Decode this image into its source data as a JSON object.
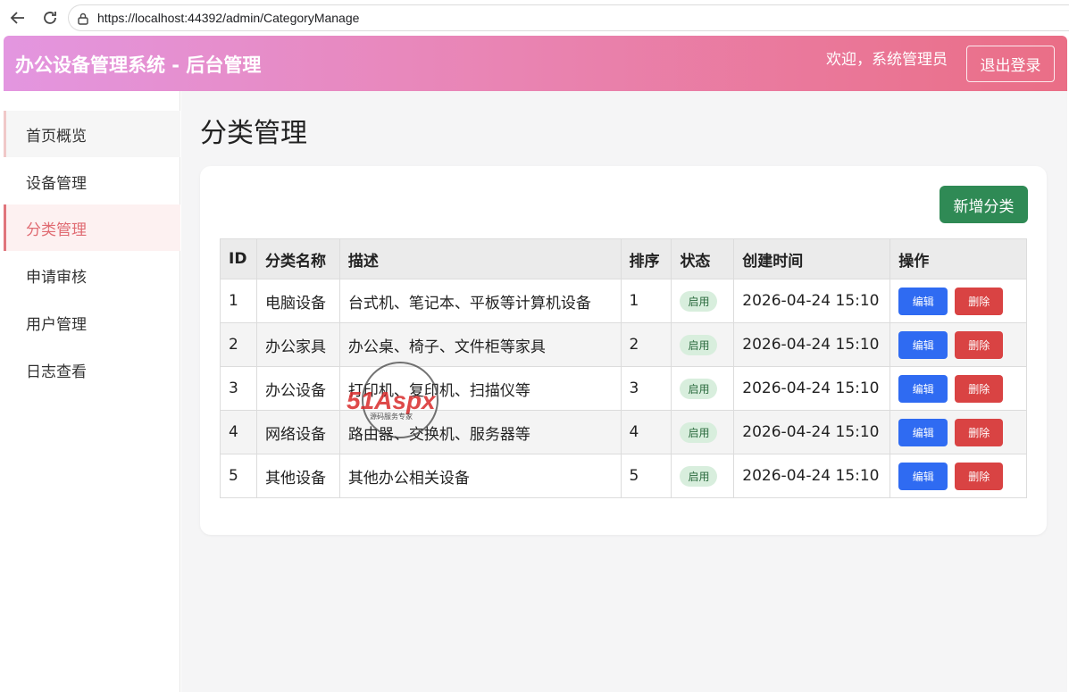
{
  "browser": {
    "url": "https://localhost:44392/admin/CategoryManage"
  },
  "header": {
    "title": "办公设备管理系统 - 后台管理",
    "welcome": "欢迎，系统管理员",
    "logout_label": "退出登录"
  },
  "sidebar": {
    "items": [
      {
        "label": "首页概览"
      },
      {
        "label": "设备管理"
      },
      {
        "label": "分类管理"
      },
      {
        "label": "申请审核"
      },
      {
        "label": "用户管理"
      },
      {
        "label": "日志查看"
      }
    ],
    "active_index": 2
  },
  "main": {
    "title": "分类管理",
    "add_label": "新增分类",
    "table": {
      "columns": [
        "ID",
        "分类名称",
        "描述",
        "排序",
        "状态",
        "创建时间",
        "操作"
      ],
      "rows": [
        {
          "id": "1",
          "name": "电脑设备",
          "desc": "台式机、笔记本、平板等计算机设备",
          "sort": "1",
          "status": "启用",
          "created": "2026-04-24 15:10",
          "edit": "编辑",
          "delete": "删除"
        },
        {
          "id": "2",
          "name": "办公家具",
          "desc": "办公桌、椅子、文件柜等家具",
          "sort": "2",
          "status": "启用",
          "created": "2026-04-24 15:10",
          "edit": "编辑",
          "delete": "删除"
        },
        {
          "id": "3",
          "name": "办公设备",
          "desc": "打印机、复印机、扫描仪等",
          "sort": "3",
          "status": "启用",
          "created": "2026-04-24 15:10",
          "edit": "编辑",
          "delete": "删除"
        },
        {
          "id": "4",
          "name": "网络设备",
          "desc": "路由器、交换机、服务器等",
          "sort": "4",
          "status": "启用",
          "created": "2026-04-24 15:10",
          "edit": "编辑",
          "delete": "删除"
        },
        {
          "id": "5",
          "name": "其他设备",
          "desc": "其他办公相关设备",
          "sort": "5",
          "status": "启用",
          "created": "2026-04-24 15:10",
          "edit": "编辑",
          "delete": "删除"
        }
      ]
    }
  },
  "watermark": {
    "brand": "51Aspx",
    "tagline": "源码服务专家"
  },
  "colors": {
    "header_gradient_start": "#e396e0",
    "header_gradient_end": "#ea6e86",
    "active_nav": "#e06b72",
    "add_button": "#2f8a55",
    "edit_button": "#2f6bf2",
    "delete_button": "#d94343",
    "status_badge_bg": "#d8eedd"
  }
}
